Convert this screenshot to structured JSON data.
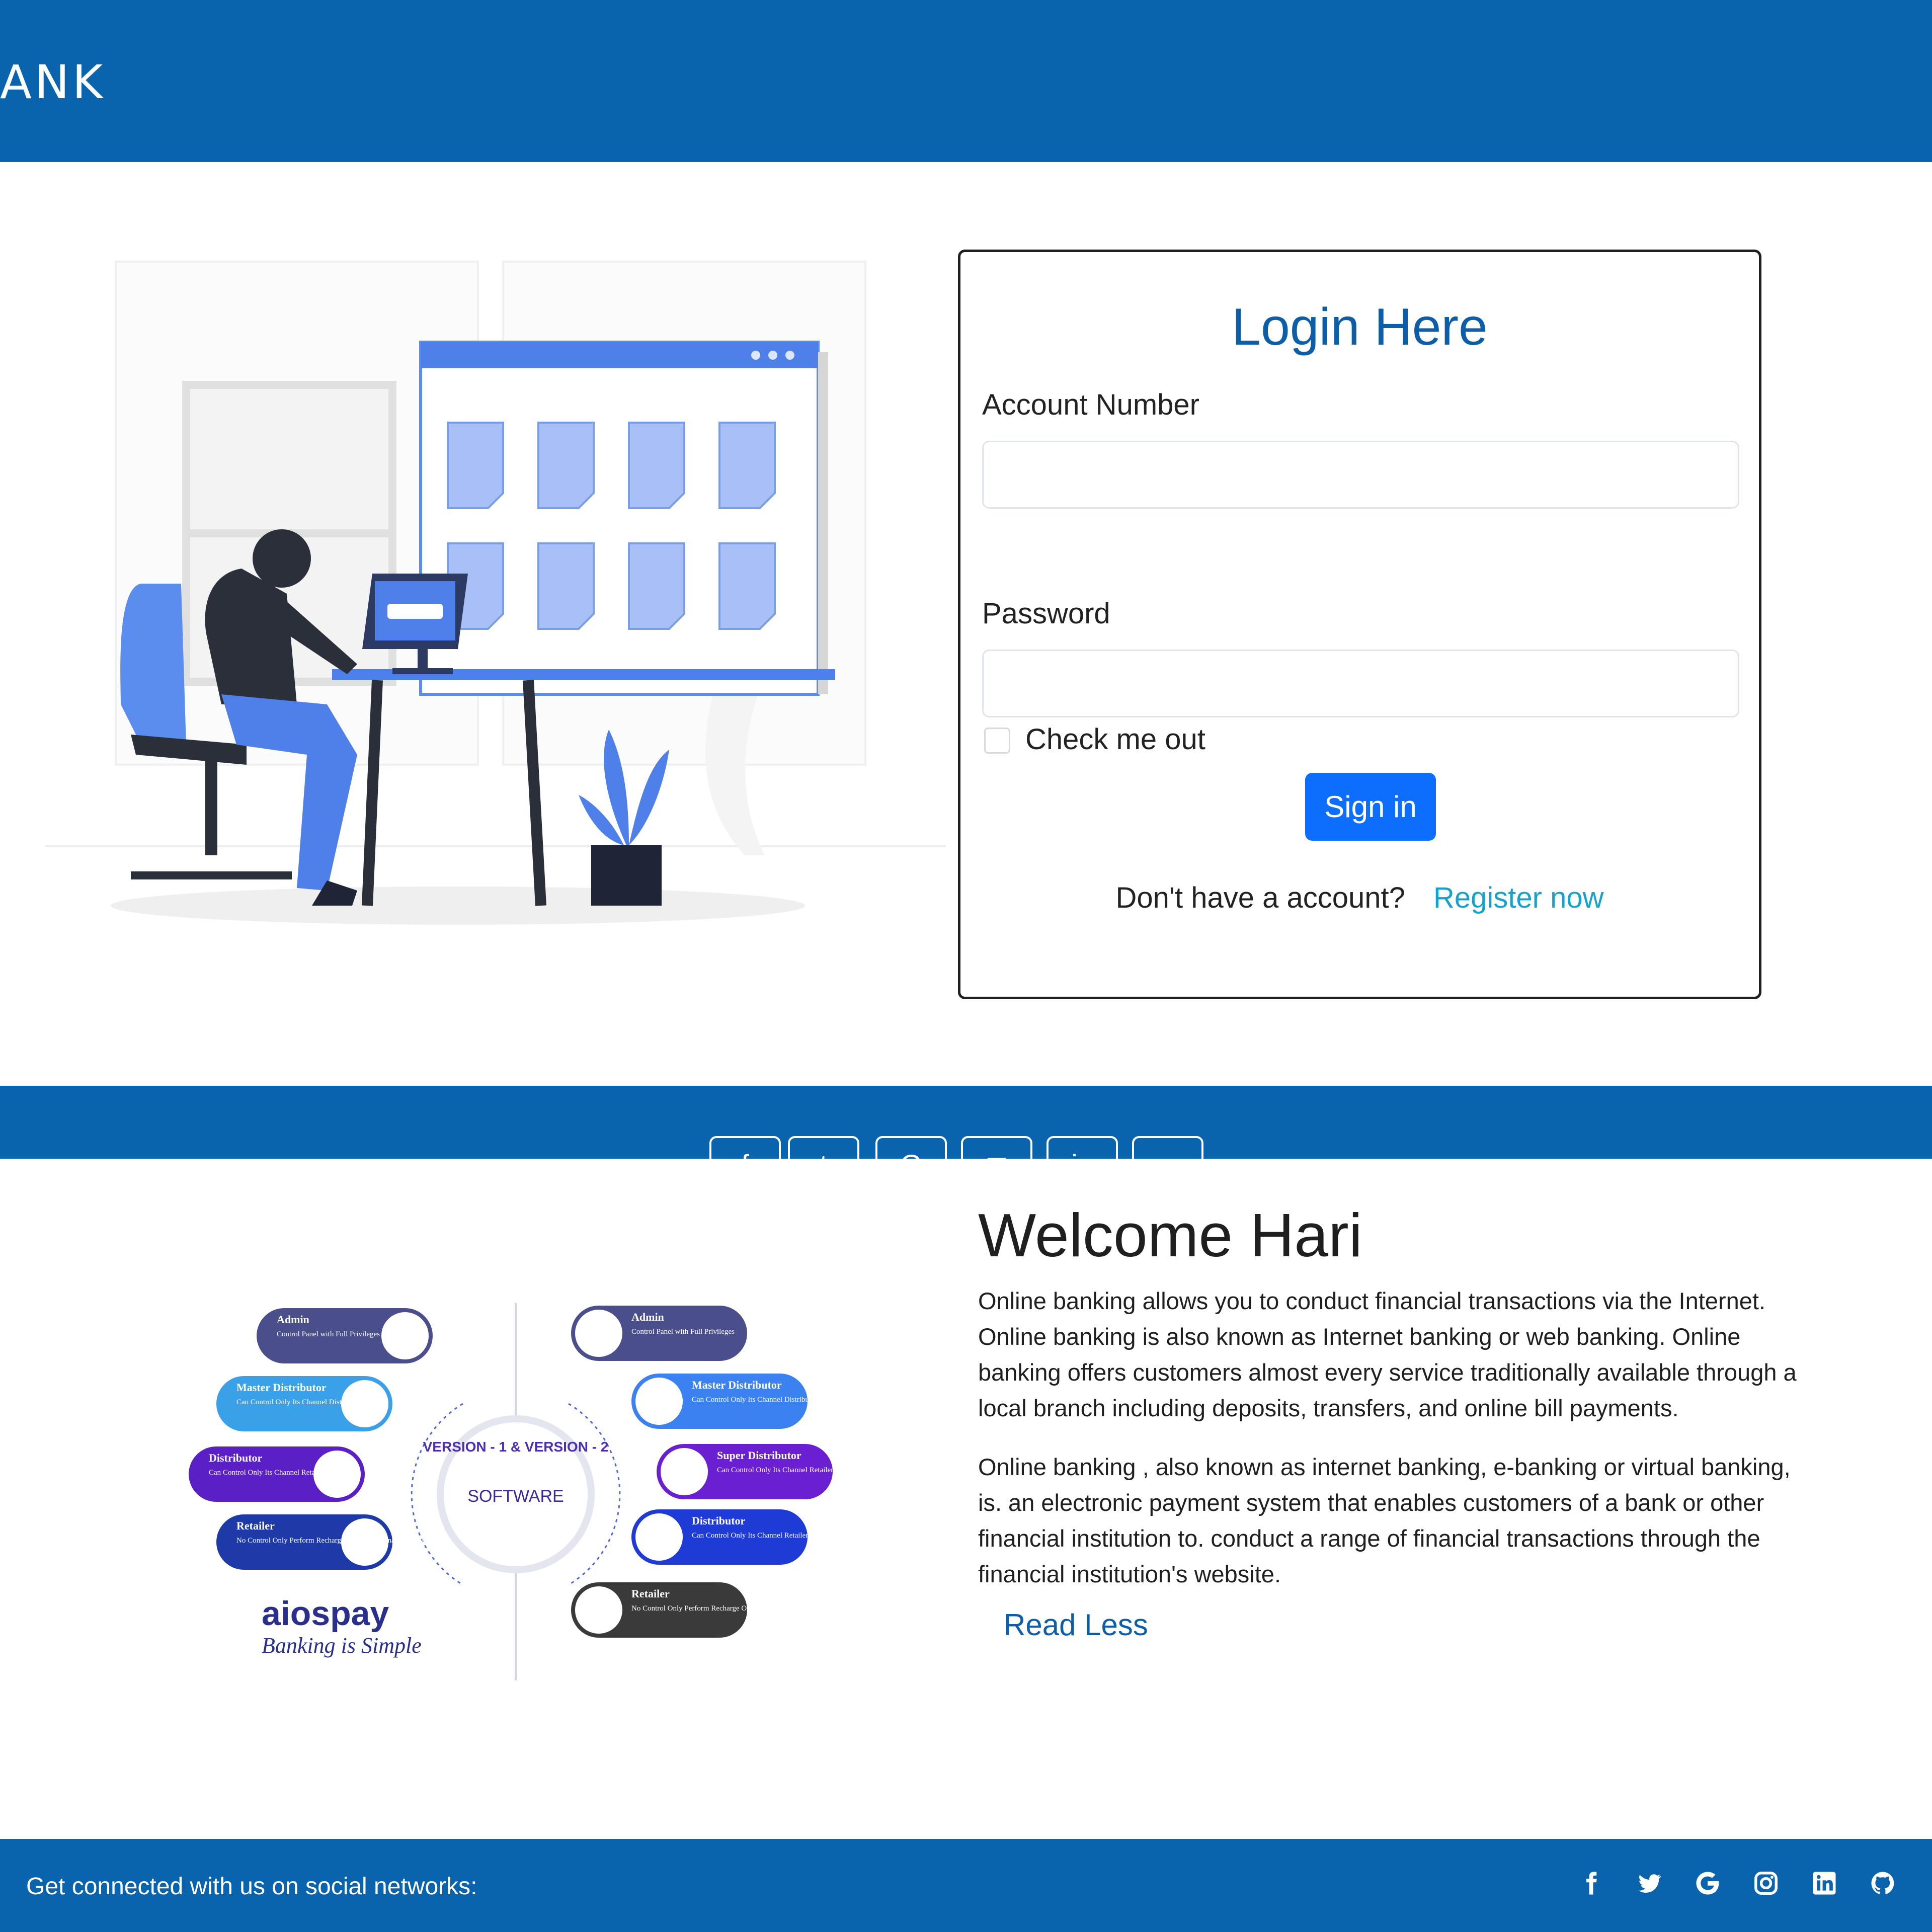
{
  "navbar": {
    "brand": "ANK"
  },
  "login": {
    "title": "Login Here",
    "account_label": "Account Number",
    "password_label": "Password",
    "check_label": "Check me out",
    "signin_label": "Sign in",
    "no_account_text": "Don't have a account?",
    "register_label": "Register now"
  },
  "graphic": {
    "center_label": "SOFTWARE",
    "ring_label": "VERSION - 1 & VERSION - 2",
    "logo_text": "aiospay",
    "logo_tagline": "Banking is Simple",
    "left_pills": [
      {
        "title": "Admin",
        "sub": "Control Panel with Full Privileges",
        "color": "#4a4f8c"
      },
      {
        "title": "Master Distributor",
        "sub": "Can Control Only Its Channel Distributor",
        "color": "#3aa0e8"
      },
      {
        "title": "Distributor",
        "sub": "Can Control Only Its Channel Retailers",
        "color": "#5b1fc6"
      },
      {
        "title": "Retailer",
        "sub": "No Control Only Perform Recharge Or Transactional Operations",
        "color": "#1d3aa8"
      }
    ],
    "right_pills": [
      {
        "title": "Admin",
        "sub": "Control Panel with Full Privileges",
        "color": "#4a4f8c"
      },
      {
        "title": "Master Distributor",
        "sub": "Can Control Only Its Channel Distributor",
        "color": "#3b82f0"
      },
      {
        "title": "Super Distributor",
        "sub": "Can Control Only Its Channel Retailers",
        "color": "#6a1fd0"
      },
      {
        "title": "Distributor",
        "sub": "Can Control Only Its Channel Retailers",
        "color": "#1f3bd6"
      },
      {
        "title": "Retailer",
        "sub": "No Control Only Perform Recharge Or Transactional Operations",
        "color": "#3a3a3a"
      }
    ]
  },
  "welcome": {
    "title": "Welcome Hari",
    "para1": "Online banking allows you to conduct financial transactions via the Internet. Online banking is also known as Internet banking or web banking. Online banking offers customers almost every service traditionally available through a local branch including deposits, transfers, and online bill payments.",
    "para2": "Online banking , also known as internet banking, e-banking or virtual banking, is. an electronic payment system that enables customers of a bank or other financial institution to. conduct a range of financial transactions through the financial institution's website.",
    "read_less": "Read Less"
  },
  "footer": {
    "text": "Get connected with us on social networks:",
    "icons": [
      "facebook-icon",
      "twitter-icon",
      "google-icon",
      "instagram-icon",
      "linkedin-icon",
      "github-icon"
    ]
  },
  "colors": {
    "primary": "#0963ad",
    "accent": "#0d6efd",
    "link": "#17a2cc",
    "title": "#0c5ea8"
  }
}
